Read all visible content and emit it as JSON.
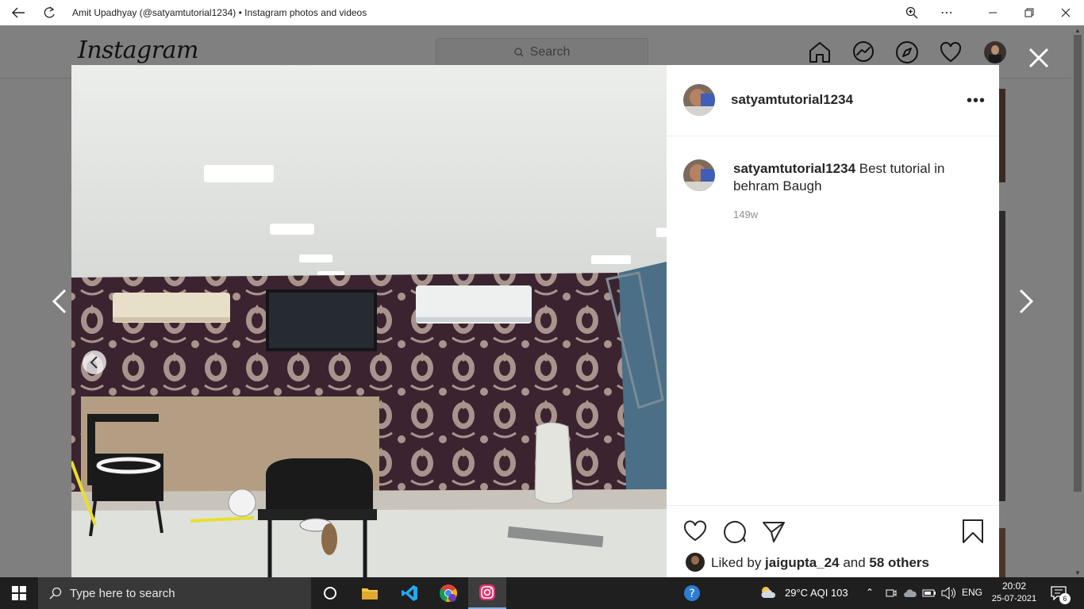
{
  "window": {
    "title": "Amit Upadhyay (@satyamtutorial1234) • Instagram photos and videos"
  },
  "instagram": {
    "logo": "Instagram",
    "search_placeholder": "Search"
  },
  "post": {
    "username": "satyamtutorial1234",
    "caption_user": "satyamtutorial1234",
    "caption_text": " Best tutorial in behram Baugh",
    "time_ago": "149w",
    "liked_prefix": "Liked by ",
    "liked_user": "jaigupta_24",
    "liked_and": " and ",
    "liked_others": "58 others"
  },
  "taskbar": {
    "search_placeholder": "Type here to search",
    "weather": "29°C  AQI 103",
    "language": "ENG",
    "time": "20:02",
    "date": "25-07-2021",
    "notifications": "6"
  },
  "colors": {
    "overlay": "#7f7f7f",
    "taskbar": "#1f1f1f",
    "accent_vscode": "#23a9f2",
    "accent_instagram": "#e1306c"
  }
}
